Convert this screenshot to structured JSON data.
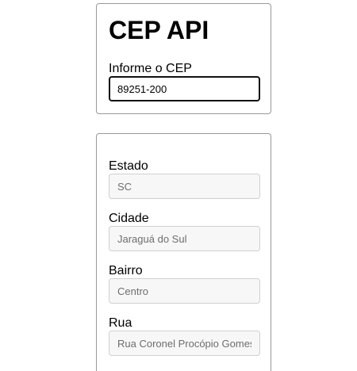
{
  "search": {
    "title": "CEP API",
    "cep_label": "Informe o CEP",
    "cep_value": "89251-200"
  },
  "address": {
    "estado_label": "Estado",
    "estado_value": "SC",
    "cidade_label": "Cidade",
    "cidade_value": "Jaraguá do Sul",
    "bairro_label": "Bairro",
    "bairro_value": "Centro",
    "rua_label": "Rua",
    "rua_value": "Rua Coronel Procópio Gomes"
  }
}
